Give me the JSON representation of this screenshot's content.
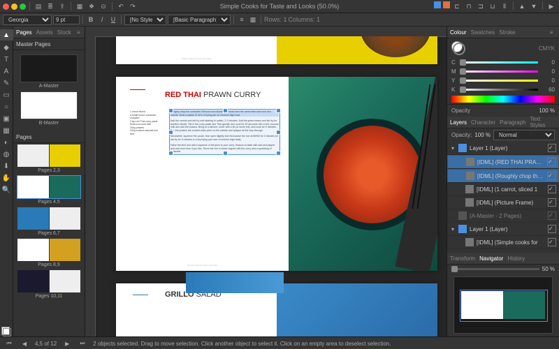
{
  "doc": {
    "title": "Simple Cooks for Taste and Looks (50.0%)"
  },
  "font": {
    "family": "Georgia",
    "size": "9 pt",
    "style": "[No Style]",
    "para": "[Basic Paragraph]"
  },
  "tb2": {
    "rows": "Rows: 1",
    "cols": "Columns: 1"
  },
  "panels": {
    "pages": "Pages",
    "assets": "Assets",
    "stock": "Stock",
    "master": "Master Pages",
    "pagesHdr": "Pages"
  },
  "masters": [
    {
      "label": "A-Master"
    },
    {
      "label": "B-Master"
    }
  ],
  "spreads": [
    {
      "label": "Pages 2,3"
    },
    {
      "label": "Pages 4,5"
    },
    {
      "label": "Pages 6,7"
    },
    {
      "label": "Pages 8,9"
    },
    {
      "label": "Pages 10,11"
    }
  ],
  "status": {
    "page": "4,5 of 12",
    "hint": "2 objects selected. Drag to move selection. Click another object to select it. Click on an empty area to deselect selection."
  },
  "colour": {
    "tab1": "Colour",
    "tab2": "Swatches",
    "tab3": "Stroke",
    "mode": "CMYK",
    "C": "0",
    "M": "0",
    "Y": "0",
    "K": "60"
  },
  "opacity": {
    "label": "Opacity",
    "val": "100 %"
  },
  "layersHdr": {
    "t1": "Layers",
    "t2": "Character",
    "t3": "Paragraph",
    "t4": "Text Styles"
  },
  "layerCtl": {
    "op": "Opacity:",
    "opv": "100 %",
    "blend": "Normal"
  },
  "layers": [
    {
      "name": "Layer 1 (Layer)",
      "top": true
    },
    {
      "name": "[IDML] (RED THAI PRAWN C",
      "sub": true,
      "sel": true
    },
    {
      "name": "[IDML] (Roughly chop the c",
      "sub": true,
      "sel": true
    },
    {
      "name": "[IDML] (1 carrot, sliced 1",
      "sub": true
    },
    {
      "name": "[IDML] (Picture Frame)",
      "sub": true
    },
    {
      "name": "(A-Master - 2 Pages)",
      "sub": false,
      "dim": true
    },
    {
      "name": "Layer 1 (Layer)",
      "top": true
    },
    {
      "name": "[IDML] (Simple cooks for",
      "sub": true
    }
  ],
  "nav": {
    "t1": "Transform",
    "t2": "Navigator",
    "t3": "History",
    "zoom": "50 %"
  },
  "recipe": {
    "title_red": "RED THAI",
    "title_rest": " PRAWN CURRY",
    "ingredients": "1 carrot sliced\na small bunch coriander, chopped\n2 tsp red Thai curry paste\ntinned coconut milk\n200g prawns\n200g cooked basmati rice\nlime",
    "p1": "Roughly chop the coriander. Remove and discard the ends from the carrot then slice into thin rounds. Heat a splash of oil in a frying pan on medium-high heat.",
    "p2": "Add the carrots and stir-fry until starting to soften, 2-3 minutes. Add the green beans and stir-fry for another minute. Stir in the curry paste and Thai garnish and cook for 30 seconds. Mix in the coconut milk and add the prawns. Bring to a simmer, cover with a lid (or some foil), and cook for 5 minutes. Tip: the prawns are cooked when pink on the outside and opaque all the way through.",
    "p3": "Meanwhile, squeeze the pouch, tear open slightly and microwave the rice at 800W for 2 minutes (or stir-fry for 3 minutes in a dry frying pan over a medium-high heat).",
    "p4": "Halve the lime and add a squeeze of the juice to your curry. Season to taste with salt and pepper and add more lime if you like. Serve the rice in bowls topped with the curry and a sprinkling of coriander.",
    "footer": "Simple cooks for taste and looks"
  },
  "grillo": {
    "title_bold": "GRILLO",
    "title_rest": " SALAD"
  }
}
